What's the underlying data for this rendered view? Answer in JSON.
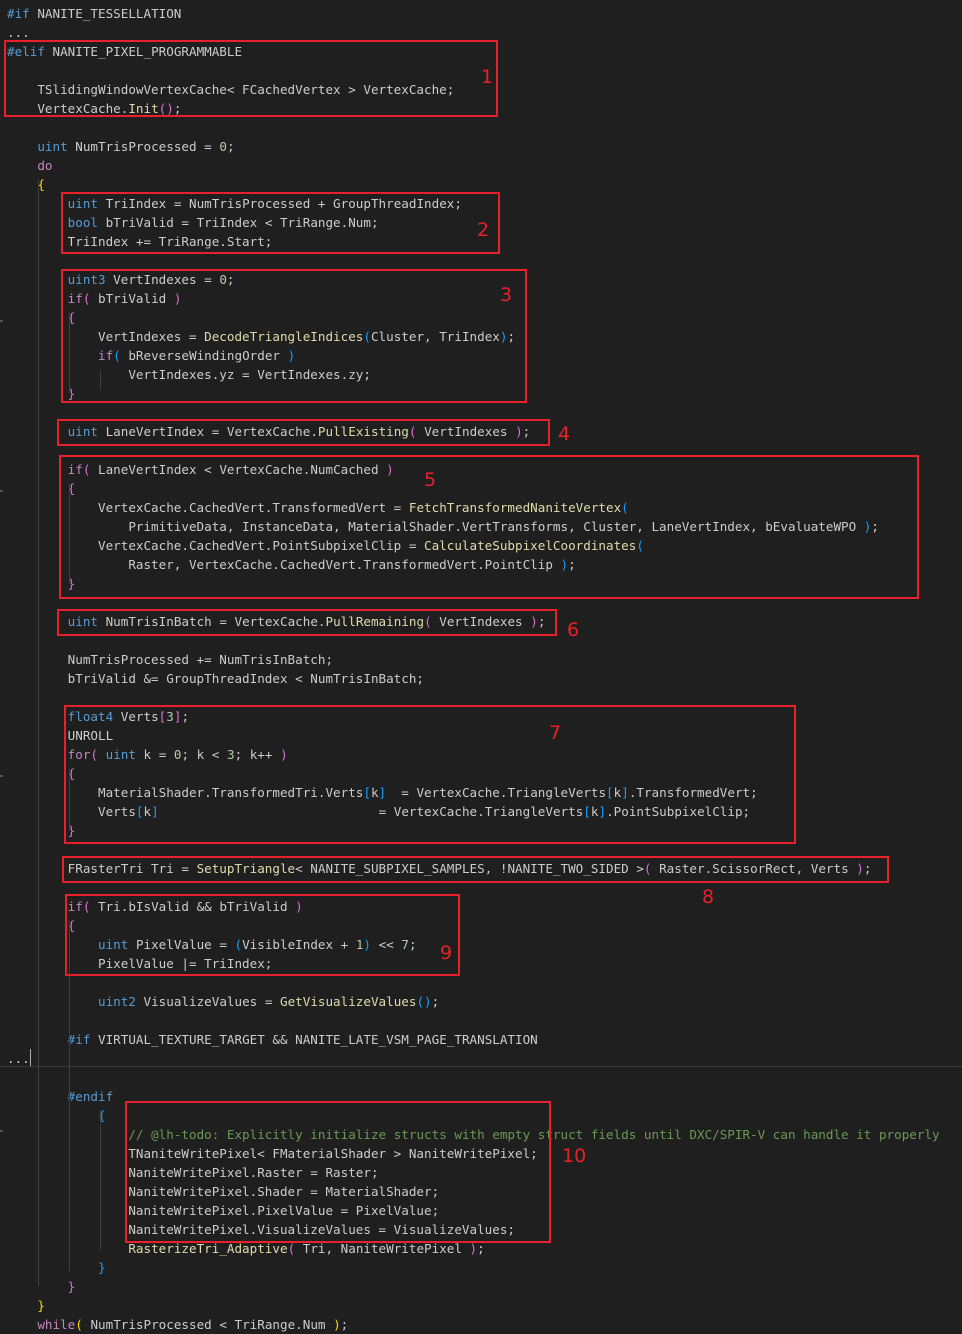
{
  "colors": {
    "background": "#1f1f1f",
    "default": "#cccccc",
    "keyword": "#569cd6",
    "control": "#c586c0",
    "function": "#dcdcaa",
    "comment": "#6a9955",
    "number": "#b5cea8",
    "bracket": "#ffd700",
    "bracket2": "#da70d6",
    "bracket3": "#179fff",
    "annotation": "#e8202a"
  },
  "code_lines": [
    [
      [
        "#if",
        "keyword"
      ],
      [
        " NANITE_TESSELLATION",
        "default"
      ]
    ],
    [
      [
        "...",
        "default"
      ]
    ],
    [
      [
        "#elif",
        "keyword"
      ],
      [
        " NANITE_PIXEL_PROGRAMMABLE",
        "default"
      ]
    ],
    [],
    [
      [
        "    TSlidingWindowVertexCache< FCachedVertex > VertexCache;",
        "default"
      ]
    ],
    [
      [
        "    VertexCache.",
        "default"
      ],
      [
        "Init",
        "function"
      ],
      [
        "()",
        "bracket2"
      ],
      [
        ";",
        "default"
      ]
    ],
    [],
    [
      [
        "    ",
        "default"
      ],
      [
        "uint",
        "keyword"
      ],
      [
        " NumTrisProcessed = ",
        "default"
      ],
      [
        "0",
        "number"
      ],
      [
        ";",
        "default"
      ]
    ],
    [
      [
        "    ",
        "default"
      ],
      [
        "do",
        "control"
      ]
    ],
    [
      [
        "    ",
        "default"
      ],
      [
        "{",
        "bracket"
      ]
    ],
    [
      [
        "        ",
        "default"
      ],
      [
        "uint",
        "keyword"
      ],
      [
        " TriIndex = NumTrisProcessed + GroupThreadIndex;",
        "default"
      ]
    ],
    [
      [
        "        ",
        "default"
      ],
      [
        "bool",
        "keyword"
      ],
      [
        " bTriValid = TriIndex < TriRange.Num;",
        "default"
      ]
    ],
    [
      [
        "        TriIndex += TriRange.Start;",
        "default"
      ]
    ],
    [],
    [
      [
        "        ",
        "default"
      ],
      [
        "uint3",
        "keyword"
      ],
      [
        " VertIndexes = ",
        "default"
      ],
      [
        "0",
        "number"
      ],
      [
        ";",
        "default"
      ]
    ],
    [
      [
        "        ",
        "default"
      ],
      [
        "if",
        "control"
      ],
      [
        "(",
        "bracket2"
      ],
      [
        " bTriValid ",
        "default"
      ],
      [
        ")",
        "bracket2"
      ]
    ],
    [
      [
        "        ",
        "default"
      ],
      [
        "{",
        "bracket2"
      ]
    ],
    [
      [
        "            VertIndexes = ",
        "default"
      ],
      [
        "DecodeTriangleIndices",
        "function"
      ],
      [
        "(",
        "bracket3"
      ],
      [
        "Cluster, TriIndex",
        "default"
      ],
      [
        ")",
        "bracket3"
      ],
      [
        ";",
        "default"
      ]
    ],
    [
      [
        "            ",
        "default"
      ],
      [
        "if",
        "control"
      ],
      [
        "(",
        "bracket3"
      ],
      [
        " bReverseWindingOrder ",
        "default"
      ],
      [
        ")",
        "bracket3"
      ]
    ],
    [
      [
        "                VertIndexes.yz = VertIndexes.zy;",
        "default"
      ]
    ],
    [
      [
        "        ",
        "default"
      ],
      [
        "}",
        "bracket2"
      ]
    ],
    [],
    [
      [
        "        ",
        "default"
      ],
      [
        "uint",
        "keyword"
      ],
      [
        " LaneVertIndex = VertexCache.",
        "default"
      ],
      [
        "PullExisting",
        "function"
      ],
      [
        "(",
        "bracket2"
      ],
      [
        " VertIndexes ",
        "default"
      ],
      [
        ")",
        "bracket2"
      ],
      [
        ";",
        "default"
      ]
    ],
    [],
    [
      [
        "        ",
        "default"
      ],
      [
        "if",
        "control"
      ],
      [
        "(",
        "bracket2"
      ],
      [
        " LaneVertIndex < VertexCache.NumCached ",
        "default"
      ],
      [
        ")",
        "bracket2"
      ]
    ],
    [
      [
        "        ",
        "default"
      ],
      [
        "{",
        "bracket2"
      ]
    ],
    [
      [
        "            VertexCache.CachedVert.TransformedVert = ",
        "default"
      ],
      [
        "FetchTransformedNaniteVertex",
        "function"
      ],
      [
        "(",
        "bracket3"
      ]
    ],
    [
      [
        "                PrimitiveData, InstanceData, MaterialShader.VertTransforms, Cluster, LaneVertIndex, bEvaluateWPO ",
        "default"
      ],
      [
        ")",
        "bracket3"
      ],
      [
        ";",
        "default"
      ]
    ],
    [
      [
        "            VertexCache.CachedVert.PointSubpixelClip = ",
        "default"
      ],
      [
        "CalculateSubpixelCoordinates",
        "function"
      ],
      [
        "(",
        "bracket3"
      ]
    ],
    [
      [
        "                Raster, VertexCache.CachedVert.TransformedVert.PointClip ",
        "default"
      ],
      [
        ")",
        "bracket3"
      ],
      [
        ";",
        "default"
      ]
    ],
    [
      [
        "        ",
        "default"
      ],
      [
        "}",
        "bracket2"
      ]
    ],
    [],
    [
      [
        "        ",
        "default"
      ],
      [
        "uint",
        "keyword"
      ],
      [
        " NumTrisInBatch = VertexCache.",
        "default"
      ],
      [
        "PullRemaining",
        "function"
      ],
      [
        "(",
        "bracket2"
      ],
      [
        " VertIndexes ",
        "default"
      ],
      [
        ")",
        "bracket2"
      ],
      [
        ";",
        "default"
      ]
    ],
    [],
    [
      [
        "        NumTrisProcessed += NumTrisInBatch;",
        "default"
      ]
    ],
    [
      [
        "        bTriValid &= GroupThreadIndex < NumTrisInBatch;",
        "default"
      ]
    ],
    [],
    [
      [
        "        ",
        "default"
      ],
      [
        "float4",
        "keyword"
      ],
      [
        " Verts",
        "default"
      ],
      [
        "[",
        "bracket2"
      ],
      [
        "3",
        "number"
      ],
      [
        "]",
        "bracket2"
      ],
      [
        ";",
        "default"
      ]
    ],
    [
      [
        "        UNROLL",
        "default"
      ]
    ],
    [
      [
        "        ",
        "default"
      ],
      [
        "for",
        "control"
      ],
      [
        "(",
        "bracket2"
      ],
      [
        " ",
        "default"
      ],
      [
        "uint",
        "keyword"
      ],
      [
        " k = ",
        "default"
      ],
      [
        "0",
        "number"
      ],
      [
        "; k < ",
        "default"
      ],
      [
        "3",
        "number"
      ],
      [
        "; k++ ",
        "default"
      ],
      [
        ")",
        "bracket2"
      ]
    ],
    [
      [
        "        ",
        "default"
      ],
      [
        "{",
        "bracket2"
      ]
    ],
    [
      [
        "            MaterialShader.TransformedTri.Verts",
        "default"
      ],
      [
        "[",
        "bracket3"
      ],
      [
        "k",
        "default"
      ],
      [
        "]",
        "bracket3"
      ],
      [
        "  = VertexCache.TriangleVerts",
        "default"
      ],
      [
        "[",
        "bracket3"
      ],
      [
        "k",
        "default"
      ],
      [
        "]",
        "bracket3"
      ],
      [
        ".TransformedVert;",
        "default"
      ]
    ],
    [
      [
        "            Verts",
        "default"
      ],
      [
        "[",
        "bracket3"
      ],
      [
        "k",
        "default"
      ],
      [
        "]",
        "bracket3"
      ],
      [
        "                             = VertexCache.TriangleVerts",
        "default"
      ],
      [
        "[",
        "bracket3"
      ],
      [
        "k",
        "default"
      ],
      [
        "]",
        "bracket3"
      ],
      [
        ".PointSubpixelClip;",
        "default"
      ]
    ],
    [
      [
        "        ",
        "default"
      ],
      [
        "}",
        "bracket2"
      ]
    ],
    [],
    [
      [
        "        FRasterTri Tri = ",
        "default"
      ],
      [
        "SetupTriangle",
        "function"
      ],
      [
        "< NANITE_SUBPIXEL_SAMPLES, !NANITE_TWO_SIDED >",
        "default"
      ],
      [
        "(",
        "bracket2"
      ],
      [
        " Raster.ScissorRect, Verts ",
        "default"
      ],
      [
        ")",
        "bracket2"
      ],
      [
        ";",
        "default"
      ]
    ],
    [],
    [
      [
        "        ",
        "default"
      ],
      [
        "if",
        "control"
      ],
      [
        "(",
        "bracket2"
      ],
      [
        " Tri.bIsValid && bTriValid ",
        "default"
      ],
      [
        ")",
        "bracket2"
      ]
    ],
    [
      [
        "        ",
        "default"
      ],
      [
        "{",
        "bracket2"
      ]
    ],
    [
      [
        "            ",
        "default"
      ],
      [
        "uint",
        "keyword"
      ],
      [
        " PixelValue = ",
        "default"
      ],
      [
        "(",
        "bracket3"
      ],
      [
        "VisibleIndex + ",
        "default"
      ],
      [
        "1",
        "number"
      ],
      [
        ")",
        "bracket3"
      ],
      [
        " << ",
        "default"
      ],
      [
        "7",
        "number"
      ],
      [
        ";",
        "default"
      ]
    ],
    [
      [
        "            PixelValue |= TriIndex;",
        "default"
      ]
    ],
    [],
    [
      [
        "            ",
        "default"
      ],
      [
        "uint2",
        "keyword"
      ],
      [
        " VisualizeValues = ",
        "default"
      ],
      [
        "GetVisualizeValues",
        "function"
      ],
      [
        "()",
        "bracket3"
      ],
      [
        ";",
        "default"
      ]
    ],
    [],
    [
      [
        "        ",
        "default"
      ],
      [
        "#if",
        "keyword"
      ],
      [
        " VIRTUAL_TEXTURE_TARGET && NANITE_LATE_VSM_PAGE_TRANSLATION",
        "default"
      ]
    ],
    [
      [
        "...",
        "default"
      ]
    ],
    [],
    [
      [
        "        ",
        "default"
      ],
      [
        "#endif",
        "keyword"
      ]
    ],
    [
      [
        "            ",
        "default"
      ],
      [
        "{",
        "bracket3"
      ]
    ],
    [
      [
        "                ",
        "default"
      ],
      [
        "// @lh-todo: Explicitly initialize structs with empty struct fields until DXC/SPIR-V can handle it properly",
        "comment"
      ]
    ],
    [
      [
        "                TNaniteWritePixel< FMaterialShader > NaniteWritePixel;",
        "default"
      ]
    ],
    [
      [
        "                NaniteWritePixel.Raster = Raster;",
        "default"
      ]
    ],
    [
      [
        "                NaniteWritePixel.Shader = MaterialShader;",
        "default"
      ]
    ],
    [
      [
        "                NaniteWritePixel.PixelValue = PixelValue;",
        "default"
      ]
    ],
    [
      [
        "                NaniteWritePixel.VisualizeValues = VisualizeValues;",
        "default"
      ]
    ],
    [
      [
        "                ",
        "default"
      ],
      [
        "RasterizeTri_Adaptive",
        "function"
      ],
      [
        "(",
        "bracket2"
      ],
      [
        " Tri, NaniteWritePixel ",
        "default"
      ],
      [
        ")",
        "bracket2"
      ],
      [
        ";",
        "default"
      ]
    ],
    [
      [
        "            ",
        "default"
      ],
      [
        "}",
        "bracket3"
      ]
    ],
    [
      [
        "        ",
        "default"
      ],
      [
        "}",
        "bracket2"
      ]
    ],
    [
      [
        "    ",
        "default"
      ],
      [
        "}",
        "bracket"
      ]
    ],
    [
      [
        "    ",
        "default"
      ],
      [
        "while",
        "control"
      ],
      [
        "(",
        "bracket"
      ],
      [
        " NumTrisProcessed < TriRange.Num ",
        "default"
      ],
      [
        ")",
        "bracket"
      ],
      [
        ";",
        "default"
      ]
    ]
  ],
  "annotations": [
    "1",
    "2",
    "3",
    "4",
    "5",
    "6",
    "7",
    "8",
    "9",
    "10"
  ]
}
